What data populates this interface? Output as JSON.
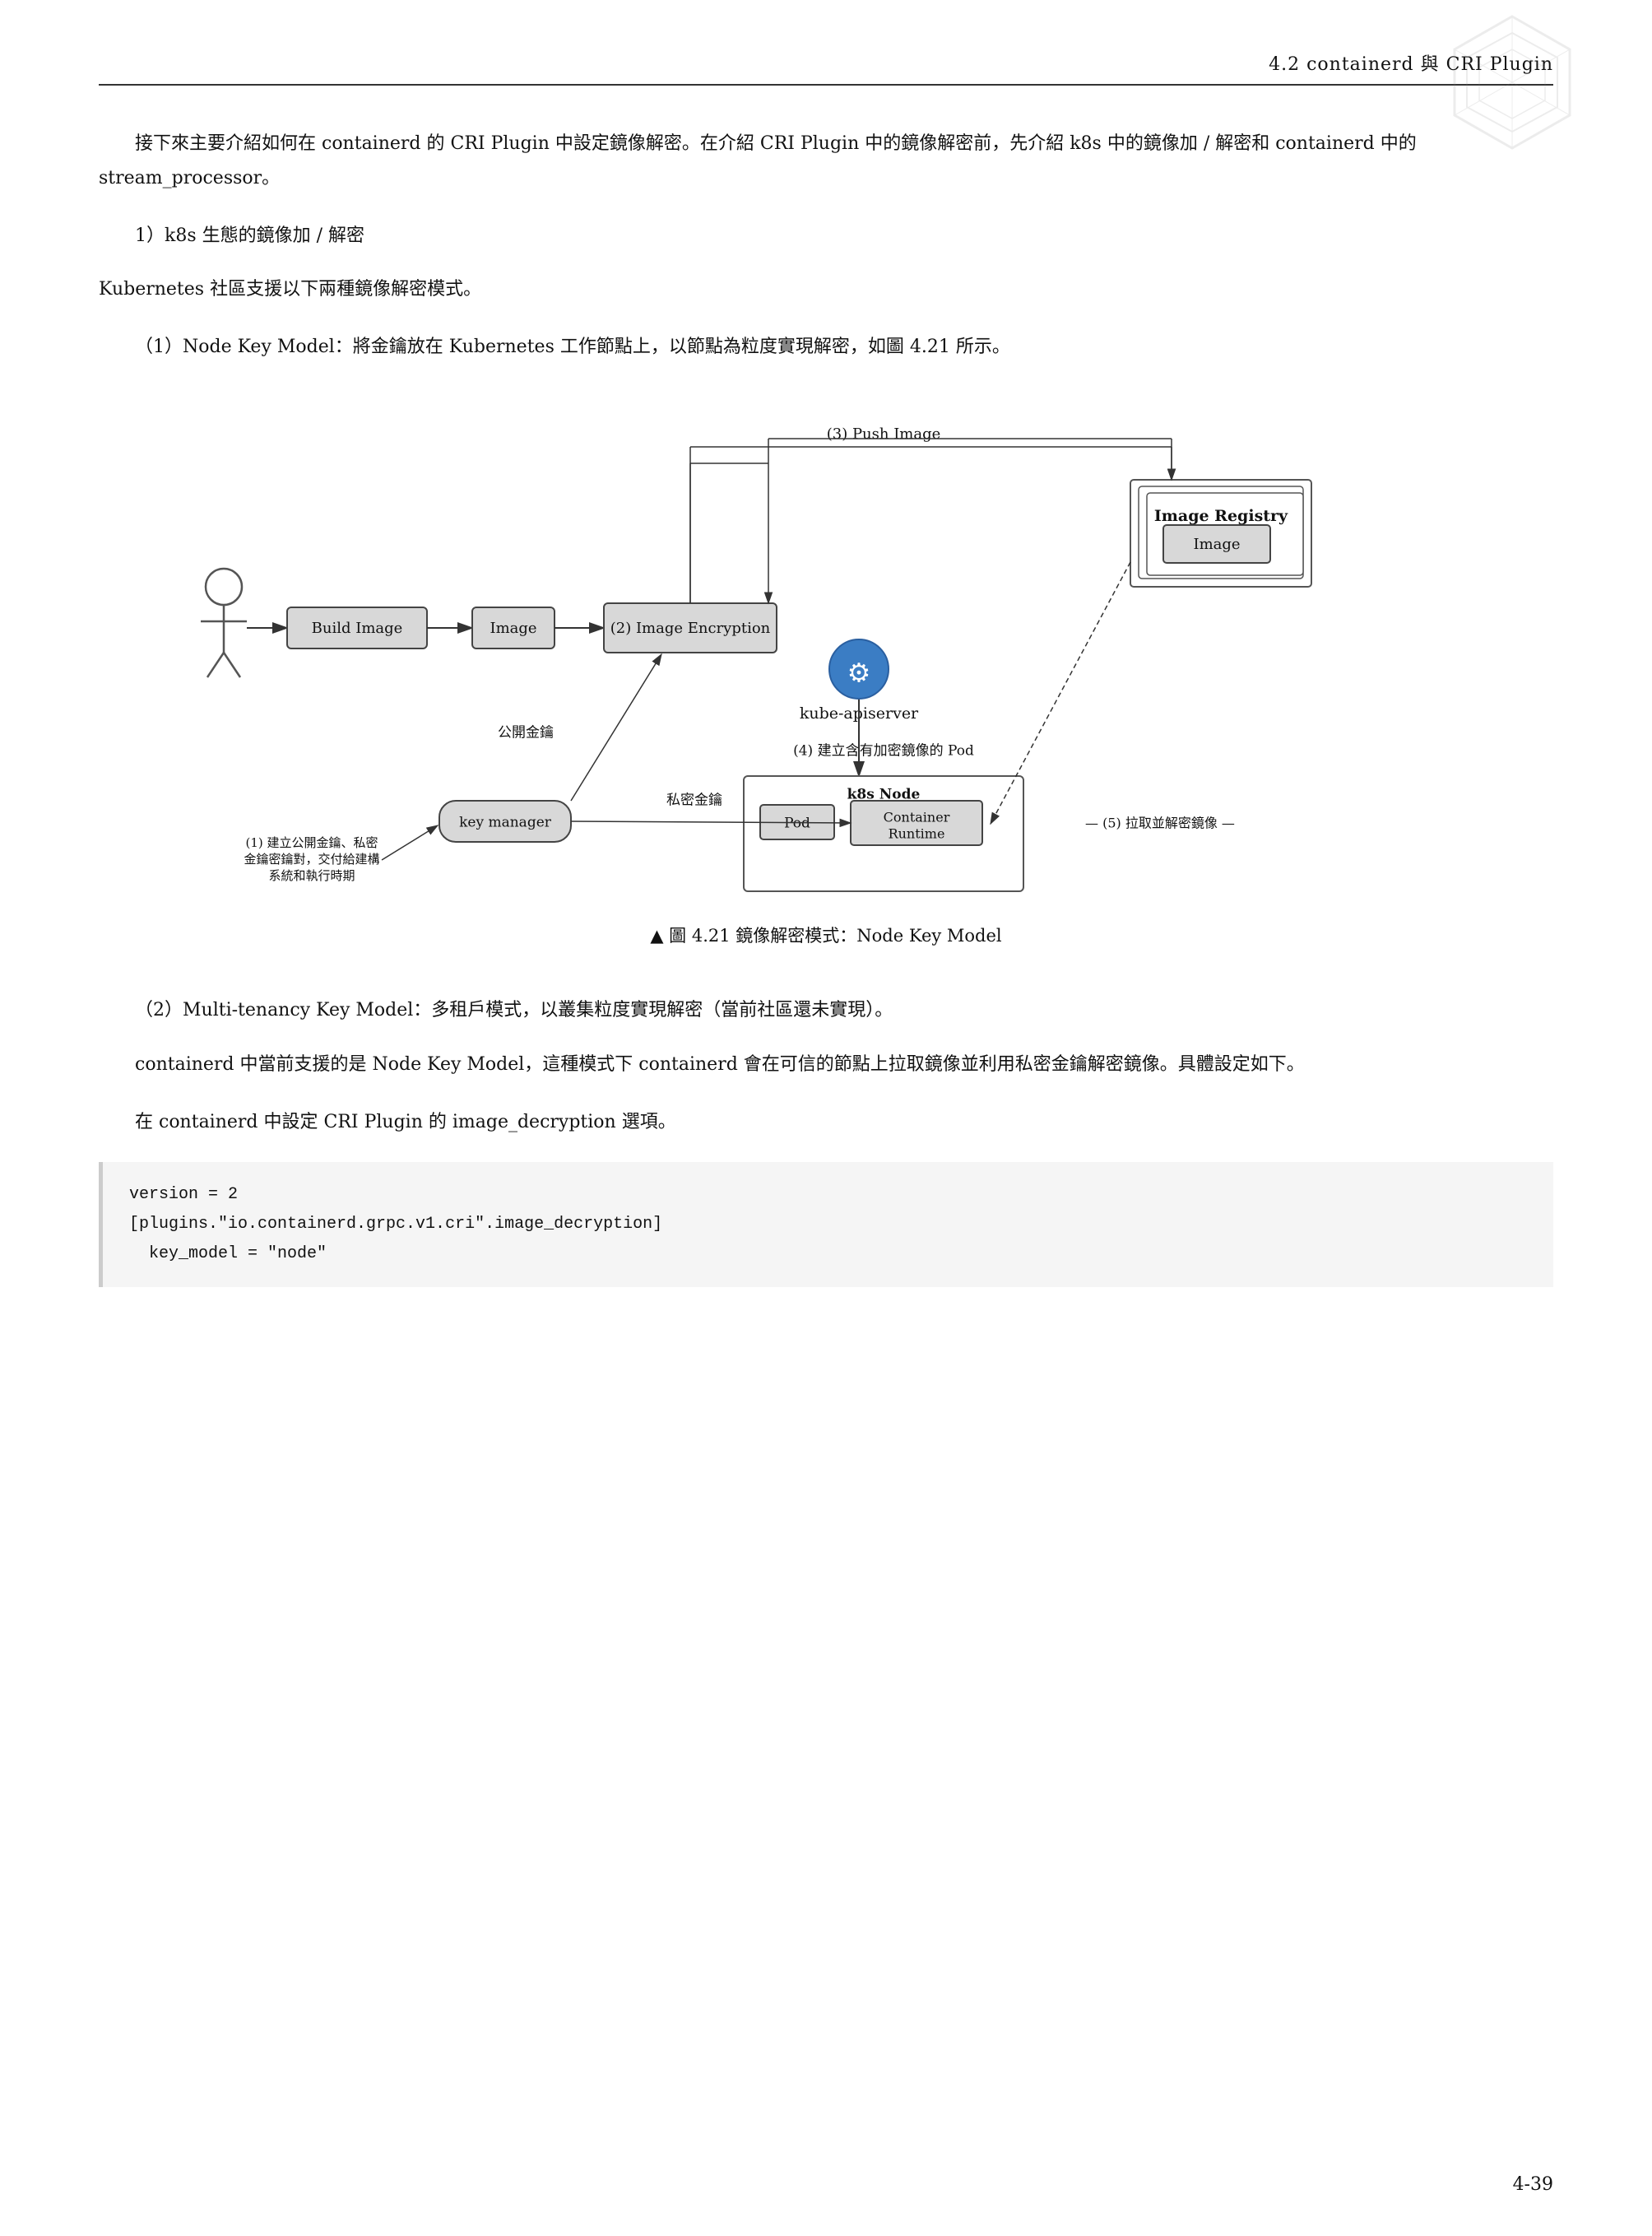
{
  "header": {
    "title": "4.2  containerd 與 CRI Plugin"
  },
  "page_number": "4-39",
  "paragraphs": {
    "intro": "接下來主要介紹如何在 containerd 的 CRI Plugin 中設定鏡像解密。在介紹 CRI Plugin 中的鏡像解密前，先介紹 k8s 中的鏡像加 / 解密和 containerd 中的 stream_processor。",
    "section1_heading": "1）k8s 生態的鏡像加 / 解密",
    "k8s_intro": "Kubernetes 社區支援以下兩種鏡像解密模式。",
    "node_key_model": "（1）Node Key Model：將金鑰放在 Kubernetes 工作節點上，以節點為粒度實現解密，如圖 4.21 所示。",
    "diagram_caption": "▲  圖 4.21  鏡像解密模式：Node Key Model",
    "multi_tenancy": "（2）Multi-tenancy Key Model：多租戶模式，以叢集粒度實現解密（當前社區還未實現）。",
    "containerd_support": "containerd 中當前支援的是 Node Key Model，這種模式下 containerd 會在可信的節點上拉取鏡像並利用私密金鑰解密鏡像。具體設定如下。",
    "cri_plugin_setting": "在 containerd 中設定 CRI Plugin 的 image_decryption 選項。"
  },
  "code": {
    "content": "version = 2\n[plugins.\"io.containerd.grpc.v1.cri\".image_decryption]\n  key_model = \"node\""
  },
  "diagram": {
    "labels": {
      "push_image": "(3) Push Image",
      "image_registry": "Image Registry",
      "image_label": "Image",
      "build_image": "Build Image",
      "image_box": "Image",
      "image_encryption": "(2) Image Encryption",
      "kube_apiserver": "kube-apiserver",
      "create_pod": "(4) 建立含有加密鏡像的 Pod",
      "k8s_node": "k8s Node",
      "pod_label": "Pod",
      "container_runtime": "Container\nRuntime",
      "pull_decrypt": "(5) 拉取並解密鏡像",
      "public_key": "公開金鑰",
      "private_key": "私密金鑰",
      "key_manager": "key manager",
      "step1_label": "(1) 建立公開金鑰、私密\n金鑰密鑰對，交付給建構\n系統和執行時期"
    }
  }
}
